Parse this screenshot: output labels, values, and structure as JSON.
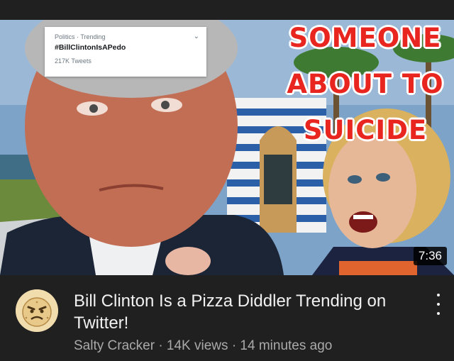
{
  "thumbnail": {
    "trend_card": {
      "category": "Politics · Trending",
      "hashtag": "#BillClintonIsAPedo",
      "tweet_count": "217K Tweets",
      "chevron": "chevron-down-icon"
    },
    "overlay_lines": [
      "SOMEONE",
      "ABOUT TO",
      "SUICIDE"
    ],
    "duration": "7:36"
  },
  "video": {
    "title": "Bill Clinton Is a Pizza Diddler Trending on Twitter!",
    "channel": "Salty Cracker",
    "views": "14K views",
    "age": "14 minutes ago",
    "separator": "·"
  },
  "colors": {
    "background": "#202020",
    "title_text": "#f1f1f1",
    "secondary_text": "#aaaaaa",
    "overlay_text": "#e8261f"
  }
}
